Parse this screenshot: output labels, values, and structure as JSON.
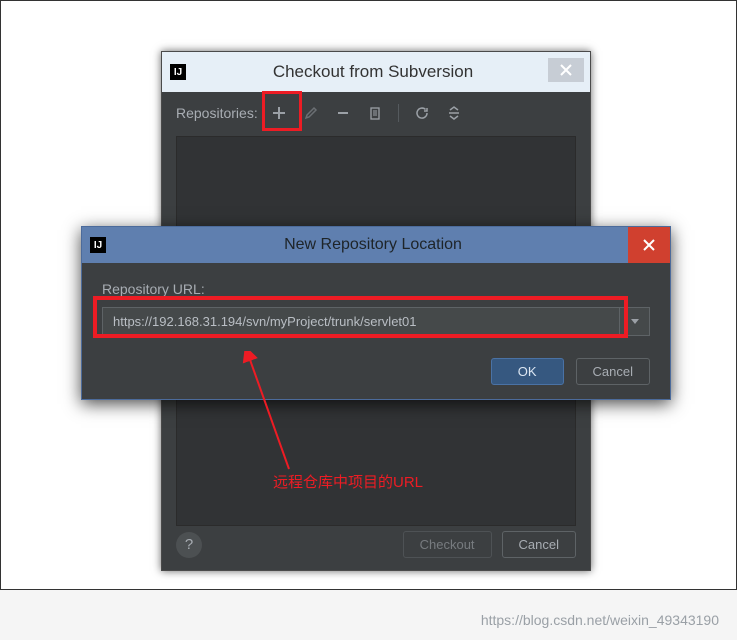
{
  "mainDialog": {
    "title": "Checkout from Subversion",
    "repositoriesLabel": "Repositories:",
    "checkoutLabel": "Checkout",
    "cancelLabel": "Cancel"
  },
  "subDialog": {
    "title": "New Repository Location",
    "fieldLabel": "Repository URL:",
    "urlValue": "https://192.168.31.194/svn/myProject/trunk/servlet01",
    "okLabel": "OK",
    "cancelLabel": "Cancel"
  },
  "annotation": "远程仓库中项目的URL",
  "watermark": "https://blog.csdn.net/weixin_49343190"
}
